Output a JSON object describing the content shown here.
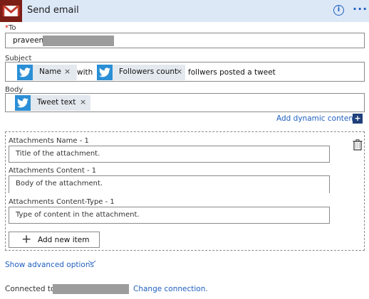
{
  "header": {
    "title": "Send email",
    "info_icon": "i",
    "more_icon": "···",
    "brand_icon": "gmail-icon"
  },
  "to": {
    "required_marker": "*",
    "label": "To",
    "value": "praveen"
  },
  "subject": {
    "label": "Subject",
    "token1": {
      "label": "Name",
      "remove": "×"
    },
    "with_text": "with",
    "token2": {
      "label": "Followers count",
      "remove": "×"
    },
    "trailing_text": "follwers posted a tweet"
  },
  "body": {
    "label": "Body",
    "token1": {
      "label": "Tweet text",
      "remove": "×"
    }
  },
  "add_dynamic": {
    "label": "Add dynamic content",
    "icon": "+"
  },
  "attachments": {
    "name_label": "Attachments Name - 1",
    "name_placeholder": "Title of the attachment.",
    "content_label": "Attachments Content - 1",
    "content_placeholder": "Body of the attachment.",
    "type_label": "Attachments Content-Type - 1",
    "type_placeholder": "Type of content in the attachment.",
    "add_item_icon": "+",
    "add_item_label": "Add new item"
  },
  "advanced": {
    "label": "Show advanced options",
    "chevron": "﹀"
  },
  "connection": {
    "connected_label": "Connected to",
    "change_label": "Change connection."
  },
  "colors": {
    "header_bg": "#dde8f7",
    "link": "#1f5fbf",
    "twitter": "#2b8fd6",
    "token_bg": "#e4e9ef"
  }
}
